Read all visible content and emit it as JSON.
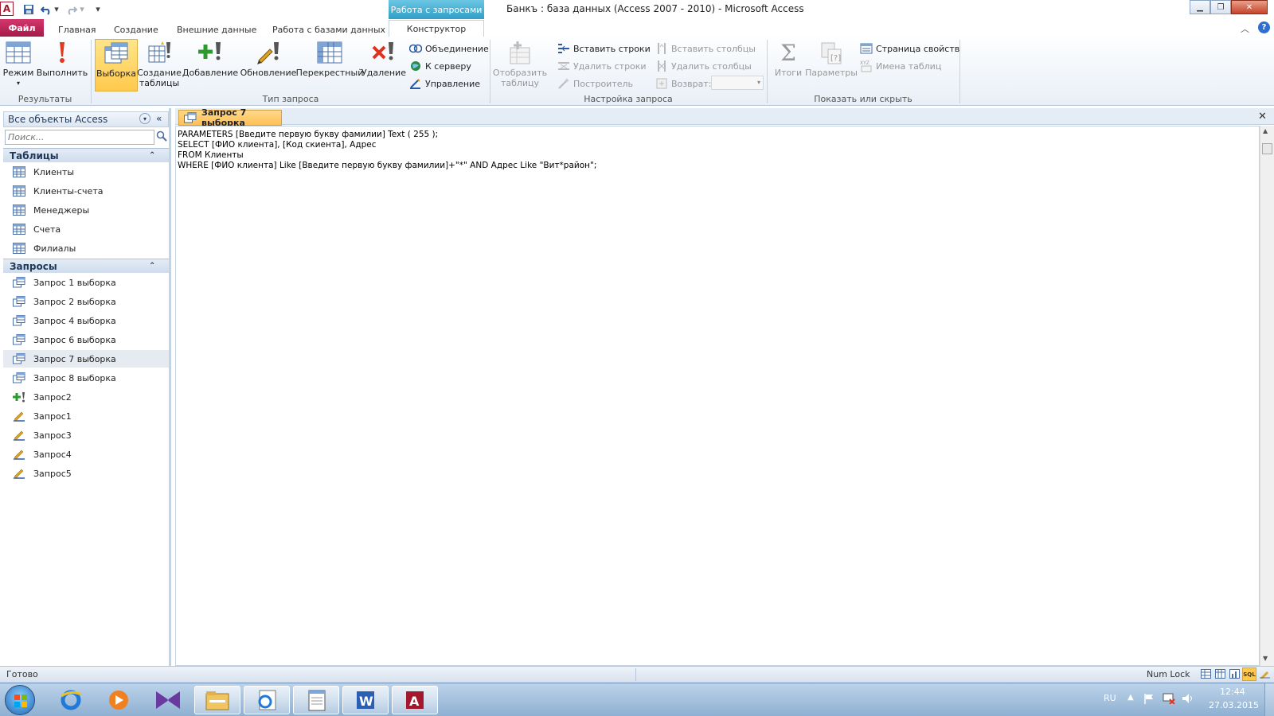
{
  "window": {
    "context_tab": "Работа с запросами",
    "title": "Банкъ : база данных (Access 2007 - 2010)  -  Microsoft Access"
  },
  "ribbon_tabs": [
    "Файл",
    "Главная",
    "Создание",
    "Внешние данные",
    "Работа с базами данных",
    "Конструктор"
  ],
  "ribbon": {
    "results": {
      "label": "Результаты",
      "mode": "Режим",
      "run": "Выполнить"
    },
    "query_type": {
      "label": "Тип запроса",
      "select": "Выборка",
      "make_table_1": "Создание",
      "make_table_2": "таблицы",
      "append": "Добавление",
      "update": "Обновление",
      "crosstab": "Перекрестный",
      "delete": "Удаление",
      "union": "Объединение",
      "pass_through": "К серверу",
      "data_definition": "Управление"
    },
    "query_setup": {
      "label": "Настройка запроса",
      "show_table_1": "Отобразить",
      "show_table_2": "таблицу",
      "insert_rows": "Вставить строки",
      "delete_rows": "Удалить строки",
      "builder": "Построитель",
      "insert_columns": "Вставить столбцы",
      "delete_columns": "Удалить столбцы",
      "return": "Возврат:"
    },
    "show_hide": {
      "label": "Показать или скрыть",
      "totals": "Итоги",
      "parameters": "Параметры",
      "property_sheet": "Страница свойств",
      "table_names": "Имена таблиц"
    }
  },
  "nav": {
    "header": "Все объекты Access",
    "search_placeholder": "Поиск...",
    "tables_label": "Таблицы",
    "tables": [
      "Клиенты",
      "Клиенты-счета",
      "Менеджеры",
      "Счета",
      "Филиалы"
    ],
    "queries_label": "Запросы",
    "queries": [
      {
        "name": "Запрос 1 выборка",
        "icon": "select-query-icon"
      },
      {
        "name": "Запрос 2 выборка",
        "icon": "select-query-icon"
      },
      {
        "name": "Запрос 4 выборка",
        "icon": "select-query-icon"
      },
      {
        "name": "Запрос 6 выборка",
        "icon": "select-query-icon"
      },
      {
        "name": "Запрос 7 выборка",
        "icon": "select-query-icon"
      },
      {
        "name": "Запрос 8 выборка",
        "icon": "select-query-icon"
      },
      {
        "name": "Запрос2",
        "icon": "append-query-icon"
      },
      {
        "name": "Запрос1",
        "icon": "update-query-icon"
      },
      {
        "name": "Запрос3",
        "icon": "update-query-icon"
      },
      {
        "name": "Запрос4",
        "icon": "update-query-icon"
      },
      {
        "name": "Запрос5",
        "icon": "update-query-icon"
      }
    ]
  },
  "document": {
    "tab_title": "Запрос 7 выборка",
    "sql_lines": [
      "PARAMETERS [Введите первую букву фамилии] Text ( 255 );",
      "SELECT [ФИО клиента], [Код скиента], Адрес",
      "FROM Клиенты",
      "WHERE [ФИО клиента] Like [Введите первую букву фамилии]+\"*\" AND Адрес Like \"Вит*район\";"
    ]
  },
  "status": {
    "left": "Готово",
    "num_lock": "Num Lock"
  },
  "taskbar": {
    "lang": "RU",
    "time": "12:44",
    "date": "27.03.2015"
  },
  "colors": {
    "file_tab": "#c4275a",
    "context_tab": "#3aa8cf",
    "selected_button": "#ffd66b",
    "doc_tab": "#ffc45c"
  }
}
